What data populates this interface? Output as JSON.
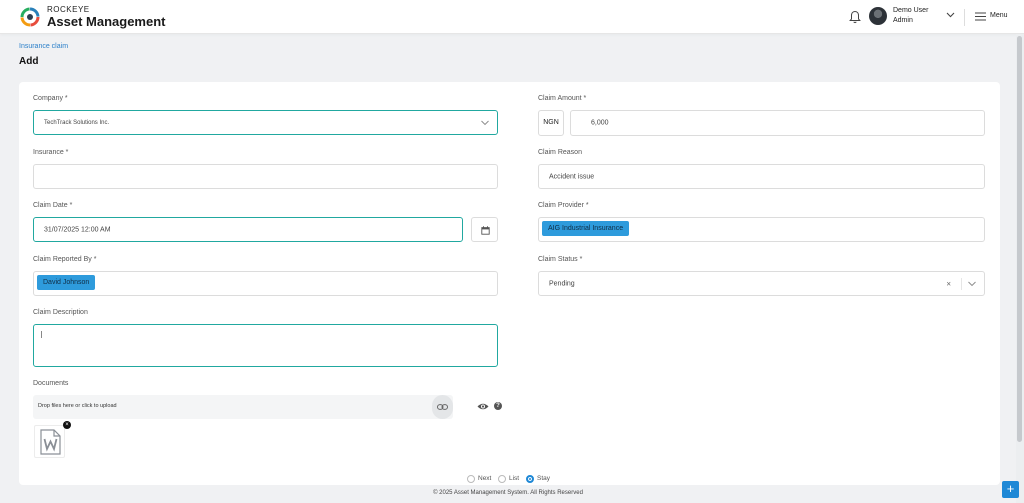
{
  "header": {
    "brand_top": "ROCKEYE",
    "brand_main": "Asset Management",
    "user_name": "Demo User",
    "user_role": "Admin",
    "menu_label": "Menu"
  },
  "breadcrumb": "Insurance claim",
  "page_title": "Add",
  "form": {
    "company": {
      "label": "Company *",
      "value": "TechTrack Solutions Inc."
    },
    "insurance": {
      "label": "Insurance *",
      "value": ""
    },
    "claim_date": {
      "label": "Claim Date *",
      "value": "31/07/2025 12:00 AM"
    },
    "claim_reported_by": {
      "label": "Claim Reported By *",
      "tag": "David Johnson"
    },
    "claim_description": {
      "label": "Claim Description",
      "value": ""
    },
    "documents": {
      "label": "Documents",
      "placeholder": "Drop files here or click to upload",
      "help": "?",
      "remove": "×"
    },
    "claim_amount": {
      "label": "Claim Amount *",
      "currency": "NGN",
      "value": "6,000"
    },
    "claim_reason": {
      "label": "Claim Reason",
      "value": "Accident issue"
    },
    "claim_provider": {
      "label": "Claim Provider *",
      "tag": "AIG Industrial Insurance"
    },
    "claim_status": {
      "label": "Claim Status *",
      "value": "Pending",
      "clear": "×"
    }
  },
  "after_save": {
    "options": [
      "Next",
      "List",
      "Stay"
    ],
    "selected": "Stay"
  },
  "footer": "© 2025 Asset Management System. All Rights Reserved",
  "fab_label": "+",
  "colors": {
    "accent": "#1e88d6",
    "focus_border": "#21a8a0",
    "tag": "#2e9bdc"
  }
}
